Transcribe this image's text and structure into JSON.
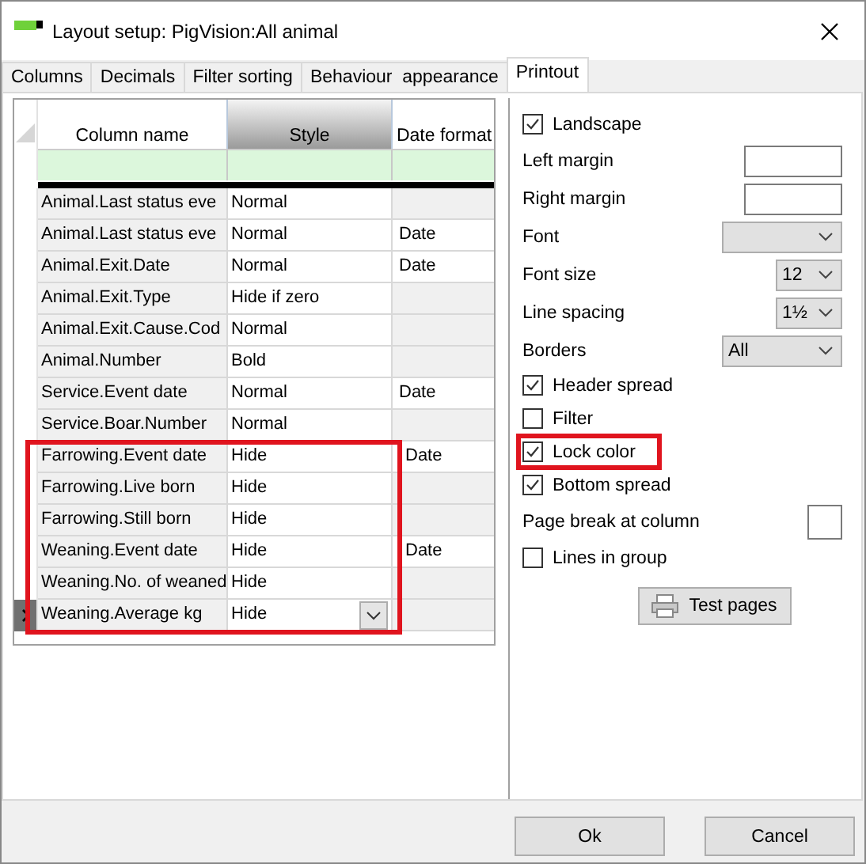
{
  "window": {
    "title": "Layout setup: PigVision:All animal"
  },
  "tabs": [
    {
      "label": "Columns",
      "selected": false
    },
    {
      "label": "Decimals",
      "selected": false
    },
    {
      "label": "Filter sorting",
      "selected": false
    },
    {
      "label": "Behaviour  appearance",
      "selected": false
    },
    {
      "label": "Printout",
      "selected": true
    }
  ],
  "table": {
    "columns": [
      "Column name",
      "Style",
      "Date format"
    ],
    "rows": [
      {
        "name": "Animal.Last status eve",
        "style": "Normal",
        "date_format": "",
        "selected": false,
        "highlighted": false
      },
      {
        "name": "Animal.Last status eve",
        "style": "Normal",
        "date_format": "Date",
        "selected": false,
        "highlighted": false
      },
      {
        "name": "Animal.Exit.Date",
        "style": "Normal",
        "date_format": "Date",
        "selected": false,
        "highlighted": false
      },
      {
        "name": "Animal.Exit.Type",
        "style": "Hide if zero",
        "date_format": "",
        "selected": false,
        "highlighted": false
      },
      {
        "name": "Animal.Exit.Cause.Cod",
        "style": "Normal",
        "date_format": "",
        "selected": false,
        "highlighted": false
      },
      {
        "name": "Animal.Number",
        "style": "Bold",
        "date_format": "",
        "selected": false,
        "highlighted": false
      },
      {
        "name": "Service.Event date",
        "style": "Normal",
        "date_format": "Date",
        "selected": false,
        "highlighted": false
      },
      {
        "name": "Service.Boar.Number",
        "style": "Normal",
        "date_format": "",
        "selected": false,
        "highlighted": false
      },
      {
        "name": "Farrowing.Event date",
        "style": "Hide",
        "date_format": "Date",
        "selected": false,
        "highlighted": true
      },
      {
        "name": "Farrowing.Live born",
        "style": "Hide",
        "date_format": "",
        "selected": false,
        "highlighted": true
      },
      {
        "name": "Farrowing.Still born",
        "style": "Hide",
        "date_format": "",
        "selected": false,
        "highlighted": true
      },
      {
        "name": "Weaning.Event date",
        "style": "Hide",
        "date_format": "Date",
        "selected": false,
        "highlighted": true
      },
      {
        "name": "Weaning.No. of weaned",
        "style": "Hide",
        "date_format": "",
        "selected": false,
        "highlighted": true
      },
      {
        "name": "Weaning.Average kg",
        "style": "Hide",
        "date_format": "",
        "selected": true,
        "highlighted": true
      }
    ]
  },
  "options": [
    {
      "kind": "checkbox",
      "label": "Landscape",
      "checked": true,
      "highlighted": false
    },
    {
      "kind": "input",
      "label": "Left margin"
    },
    {
      "kind": "input",
      "label": "Right margin"
    },
    {
      "kind": "select",
      "label": "Font"
    },
    {
      "kind": "small-select",
      "label": "Font size",
      "value": "12"
    },
    {
      "kind": "small-select",
      "label": "Line spacing",
      "value": "1½"
    },
    {
      "kind": "select",
      "label": "Borders",
      "value": "All"
    },
    {
      "kind": "checkbox",
      "label": "Header spread",
      "checked": true,
      "highlighted": false
    },
    {
      "kind": "checkbox",
      "label": "Filter",
      "checked": false,
      "highlighted": false
    },
    {
      "kind": "checkbox",
      "label": "Lock color",
      "checked": true,
      "highlighted": true
    },
    {
      "kind": "checkbox",
      "label": "Bottom spread",
      "checked": true,
      "highlighted": false
    },
    {
      "kind": "box-input",
      "label": "Page break at column"
    },
    {
      "kind": "checkbox",
      "label": "Lines in group",
      "checked": false,
      "highlighted": false
    }
  ],
  "test_button": "Test pages",
  "buttons": [
    "Ok",
    "Cancel"
  ]
}
